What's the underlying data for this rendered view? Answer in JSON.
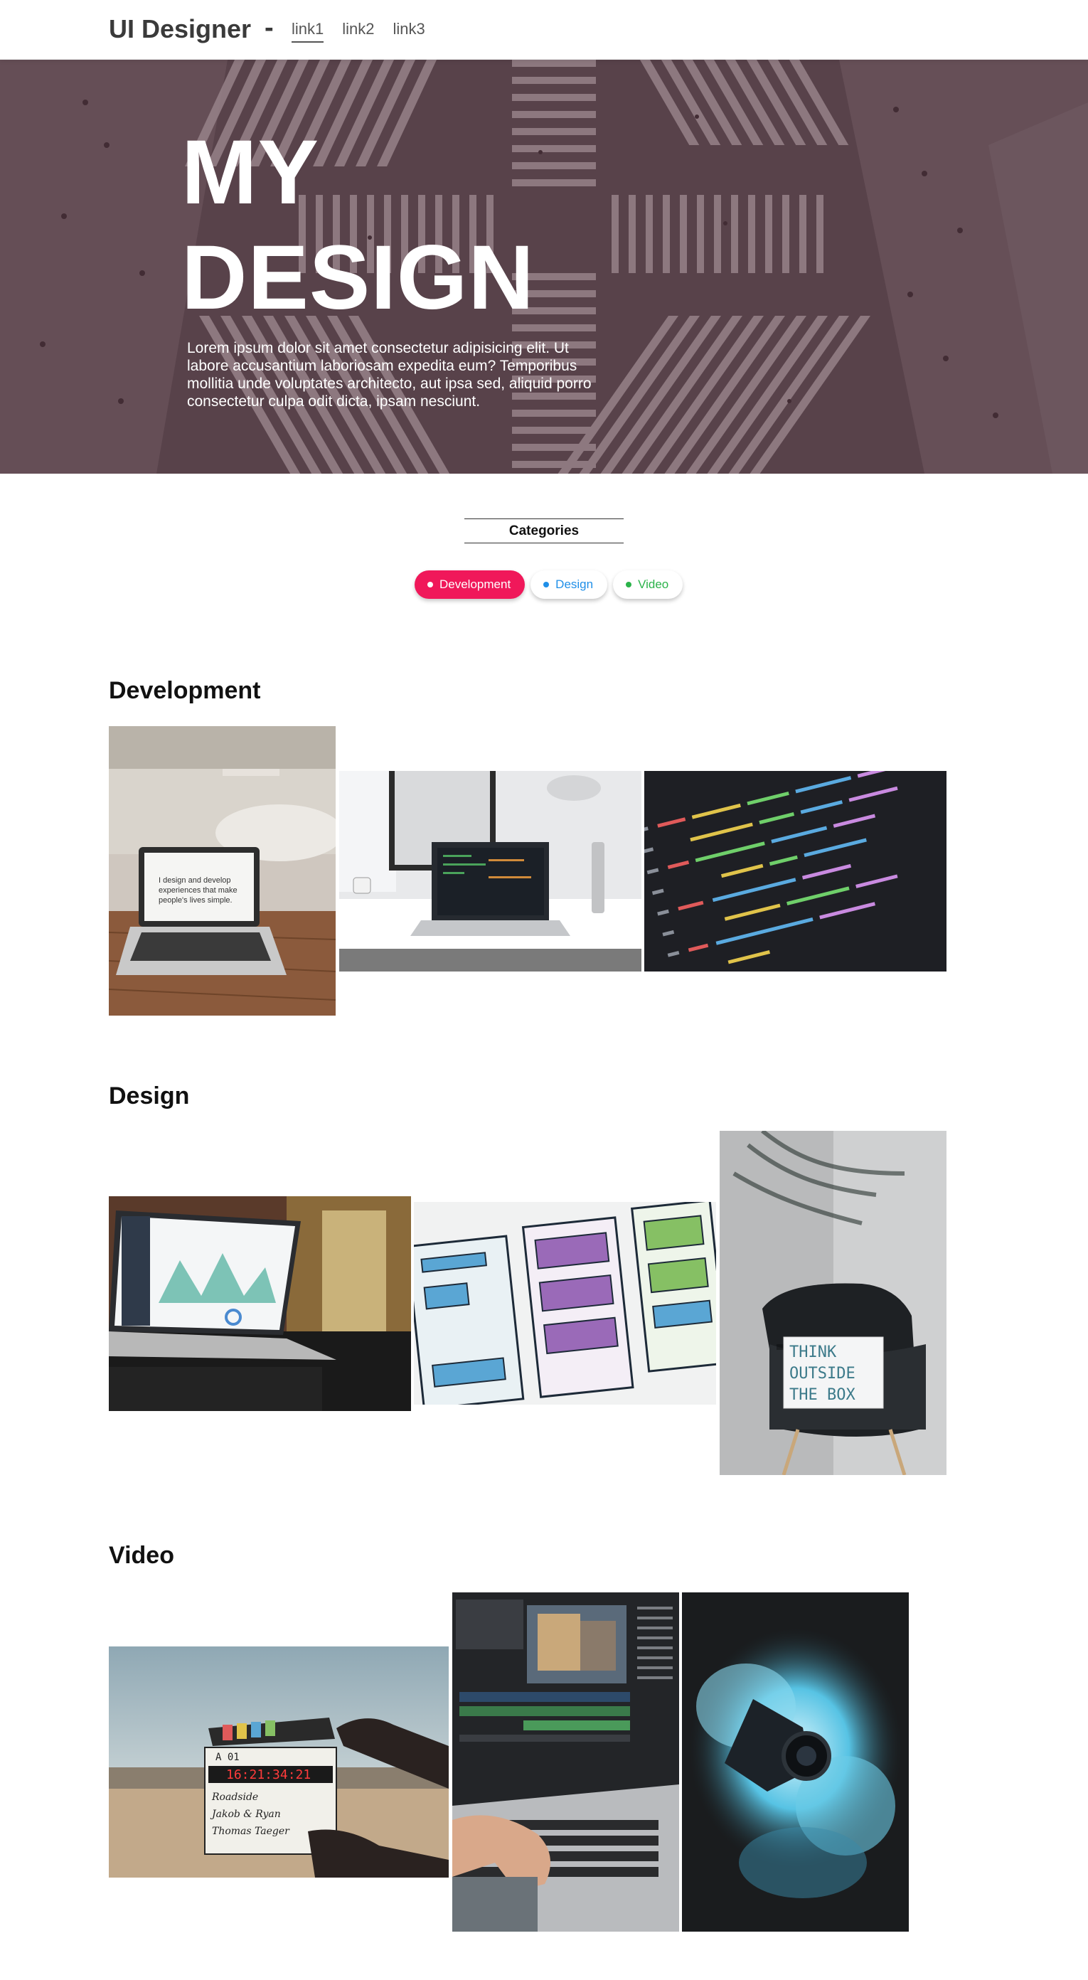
{
  "nav": {
    "brand": "UI Designer",
    "separator": "-",
    "links": [
      "link1",
      "link2",
      "link3"
    ],
    "active_link": "link1"
  },
  "hero": {
    "title_line1": "MY",
    "title_line2": "DESIGN",
    "description": "Lorem ipsum dolor sit amet consectetur adipisicing elit. Ut labore accusantium laboriosam expedita eum? Temporibus mollitia unde voluptates architecto, aut ipsa sed, aliquid porro consectetur culpa odit dicta, ipsam nesciunt."
  },
  "categories": {
    "title": "Categories",
    "filters": [
      {
        "label": "Development",
        "color": "#f0185a",
        "active": true
      },
      {
        "label": "Design",
        "color": "#1f8fe8",
        "active": false
      },
      {
        "label": "Video",
        "color": "#2bb34a",
        "active": false
      }
    ]
  },
  "sections": [
    {
      "title": "Development",
      "photos": [
        "laptop-on-cafe-table-photo",
        "laptop-on-desk-photo",
        "code-on-screen-photo"
      ],
      "laptop_screen_text": "I design and develop experiences that make people's lives simple."
    },
    {
      "title": "Design",
      "photos": [
        "analytics-dashboard-laptop-photo",
        "watercolor-wireframe-sketch-photo",
        "lightbox-on-chair-photo"
      ],
      "lightbox_text": [
        "THINK",
        "OUTSIDE",
        "THE  BOX"
      ]
    },
    {
      "title": "Video",
      "photos": [
        "film-clapperboard-photo",
        "video-editing-laptop-photo",
        "camera-in-smoke-photo"
      ],
      "clapper_text": [
        "A 01",
        "16:21:34:21",
        "Roadside",
        "Jakob & Ryan",
        "Thomas Taeger"
      ]
    }
  ]
}
